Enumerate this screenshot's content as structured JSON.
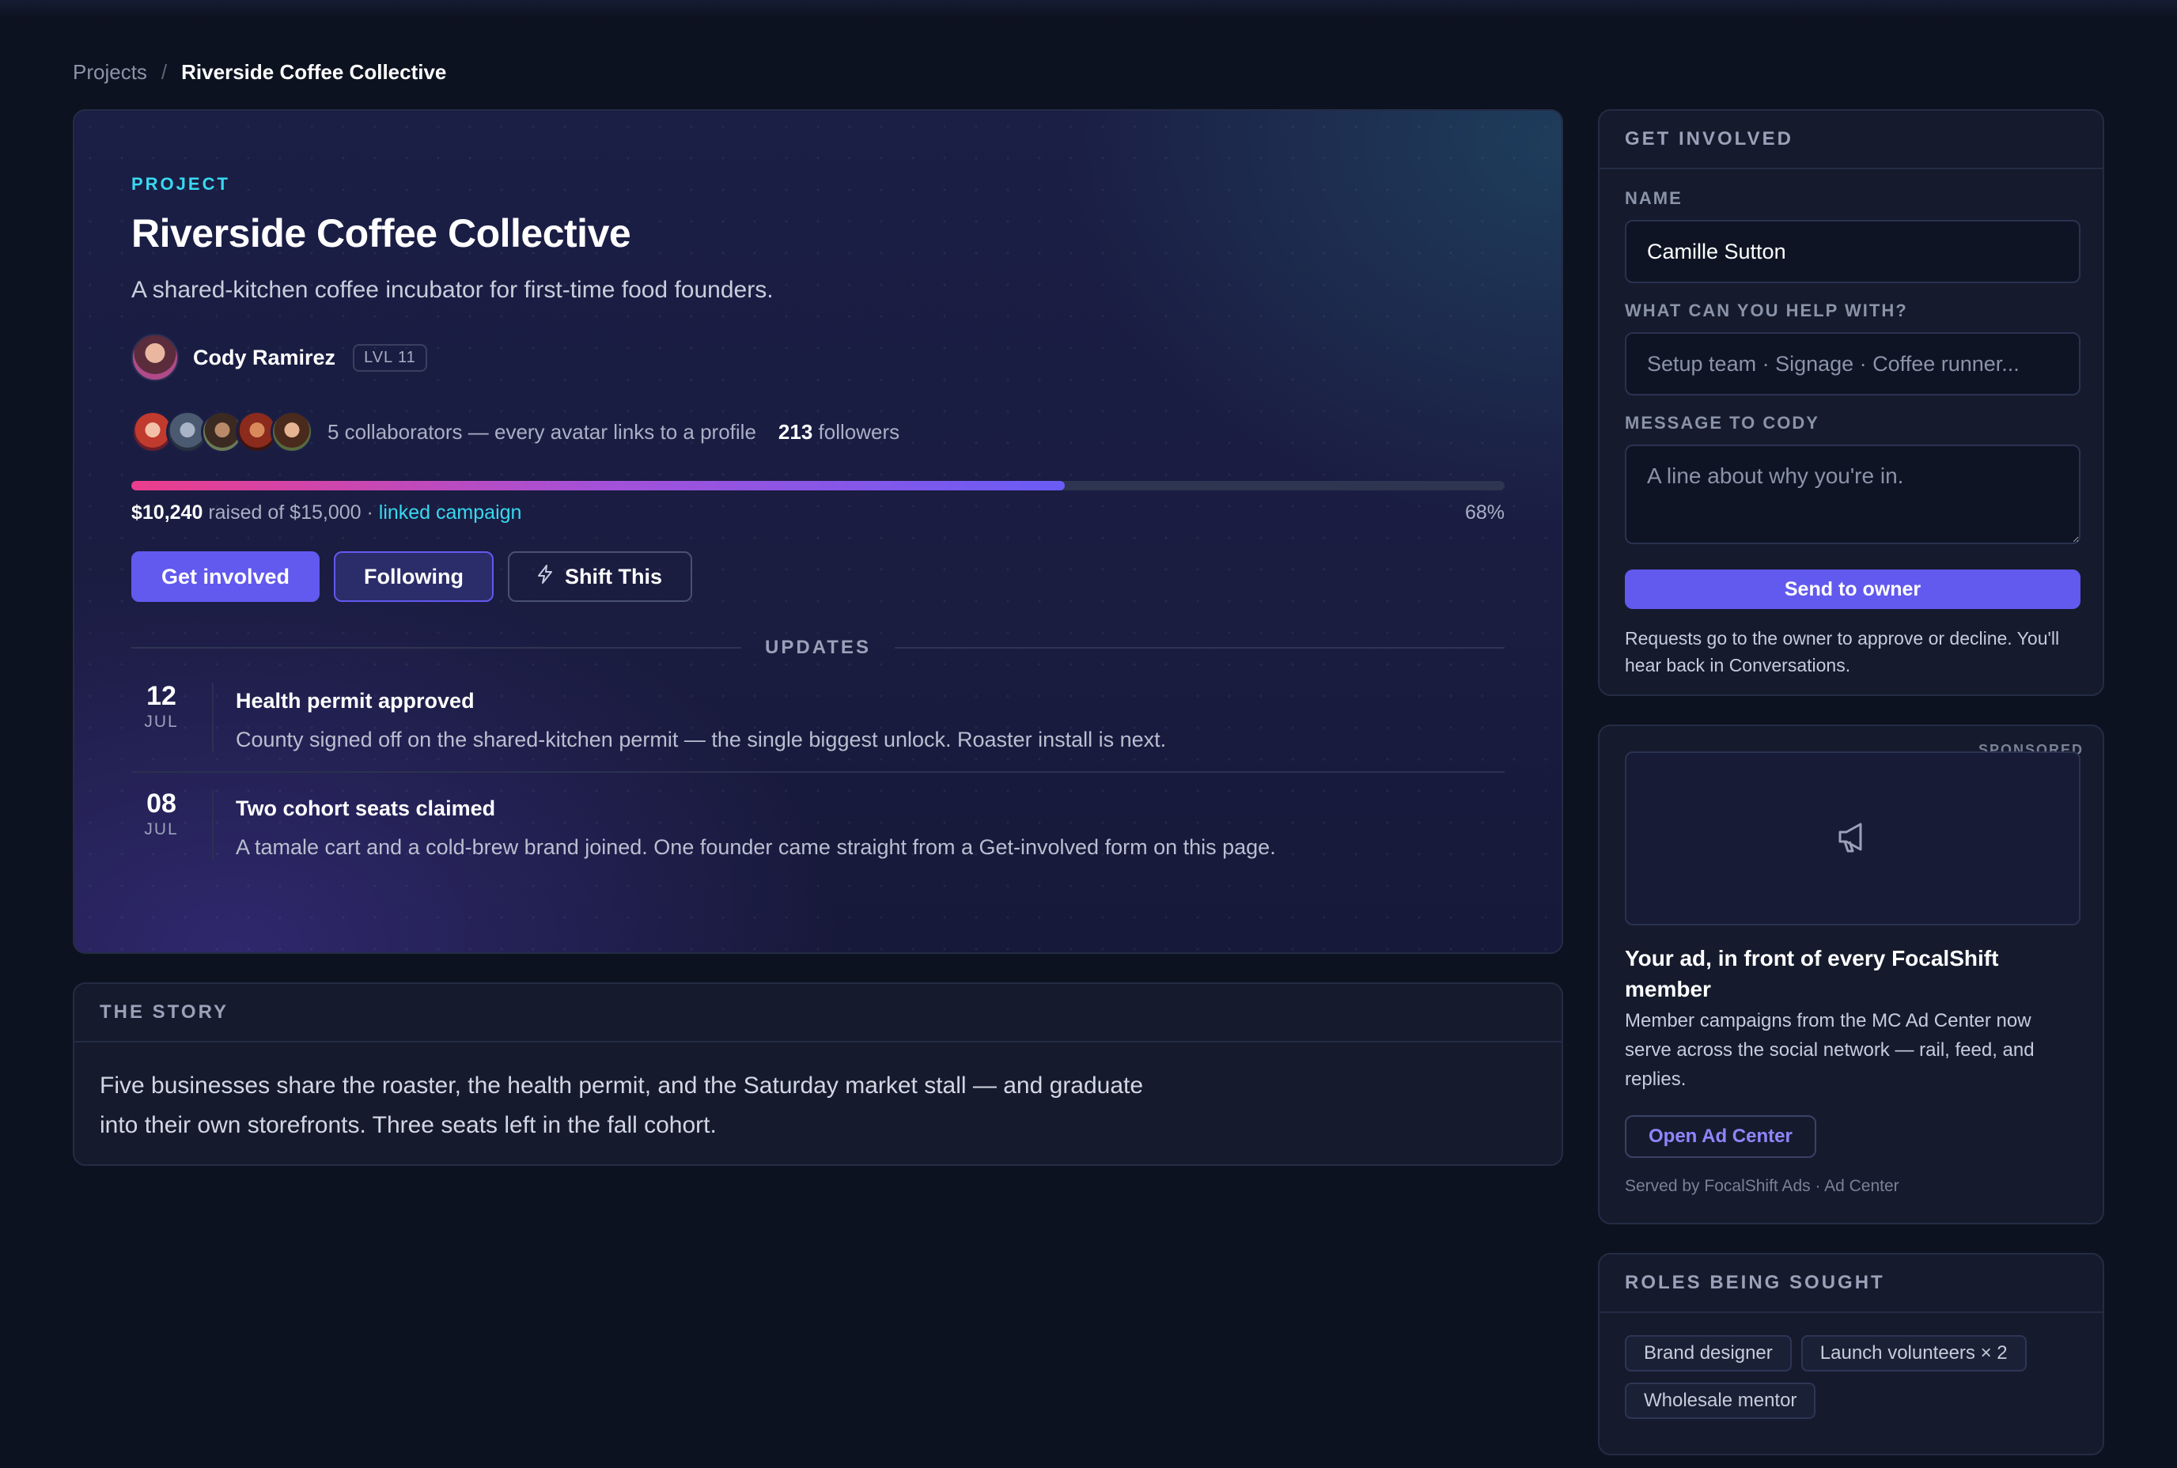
{
  "breadcrumb": {
    "parent": "Projects",
    "separator": "/",
    "current": "Riverside Coffee Collective"
  },
  "project": {
    "eyebrow": "PROJECT",
    "title": "Riverside Coffee Collective",
    "subtitle": "A shared-kitchen coffee incubator for first-time food founders.",
    "owner": {
      "name": "Cody Ramirez",
      "level": "LVL 11"
    },
    "collaborators_text": "5 collaborators — every avatar links to a profile",
    "followers_count": "213",
    "followers_label": "followers",
    "progress": {
      "percent_value": 68,
      "raised": "$10,240",
      "raised_of": "raised of $15,000 ·",
      "campaign_link": "linked campaign",
      "percent_label": "68%"
    },
    "buttons": {
      "get_involved": "Get involved",
      "following": "Following",
      "shift": "Shift This"
    },
    "updates_label": "UPDATES",
    "updates": [
      {
        "day": "12",
        "month": "JUL",
        "title": "Health permit approved",
        "text": "County signed off on the shared-kitchen permit — the single biggest unlock. Roaster install is next."
      },
      {
        "day": "08",
        "month": "JUL",
        "title": "Two cohort seats claimed",
        "text": "A tamale cart and a cold-brew brand joined. One founder came straight from a Get-involved form on this page."
      }
    ]
  },
  "story": {
    "heading": "THE STORY",
    "text": "Five businesses share the roaster, the health permit, and the Saturday market stall — and graduate into their own storefronts. Three seats left in the fall cohort."
  },
  "get_involved": {
    "heading": "GET INVOLVED",
    "name_label": "NAME",
    "name_value": "Camille Sutton",
    "help_label": "WHAT CAN YOU HELP WITH?",
    "help_placeholder": "Setup team · Signage · Coffee runner...",
    "message_label": "MESSAGE TO CODY",
    "message_placeholder": "A line about why you're in.",
    "send_label": "Send to owner",
    "note": "Requests go to the owner to approve or decline. You'll hear back in Conversations."
  },
  "ad": {
    "sponsored": "SPONSORED",
    "icon": "megaphone-icon",
    "title": "Your ad, in front of every FocalShift member",
    "text": "Member campaigns from the MC Ad Center now serve across the social network — rail, feed, and replies.",
    "button": "Open Ad Center",
    "footer": "Served by FocalShift Ads · Ad Center"
  },
  "roles": {
    "heading": "ROLES BEING SOUGHT",
    "items": [
      "Brand designer",
      "Launch volunteers × 2",
      "Wholesale mentor"
    ]
  },
  "colors": {
    "accent": "#6259ee",
    "cyan": "#38d9f0",
    "background": "#0d1220"
  }
}
